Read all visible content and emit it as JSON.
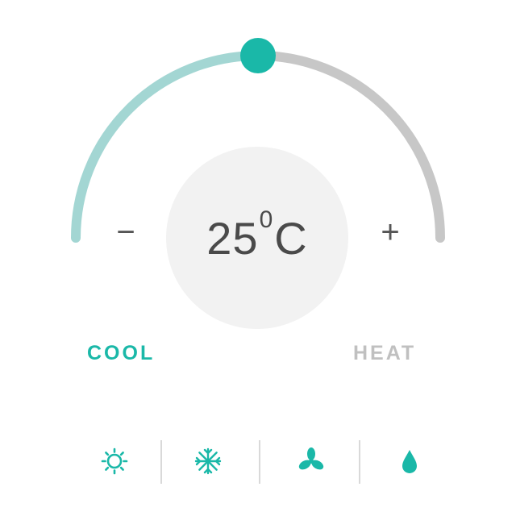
{
  "temperature": {
    "value": "25",
    "degree_symbol": "0",
    "unit": "C",
    "slider_fraction": 0.5
  },
  "controls": {
    "decrease_label": "−",
    "increase_label": "+"
  },
  "modes": {
    "cool_label": "COOL",
    "heat_label": "HEAT",
    "active": "cool"
  },
  "bottom_bar": [
    {
      "icon": "sun-icon",
      "label": "sun"
    },
    {
      "icon": "snowflake-icon",
      "label": "snowflake"
    },
    {
      "icon": "fan-icon",
      "label": "fan"
    },
    {
      "icon": "water-drop-icon",
      "label": "drop"
    }
  ],
  "colors": {
    "accent": "#1ab8a8",
    "accent_light": "#a3d6d3",
    "track": "#c7c7c7",
    "inactive_text": "#c0c0c0",
    "disc": "#f2f2f2",
    "text": "#4a4a4a"
  }
}
